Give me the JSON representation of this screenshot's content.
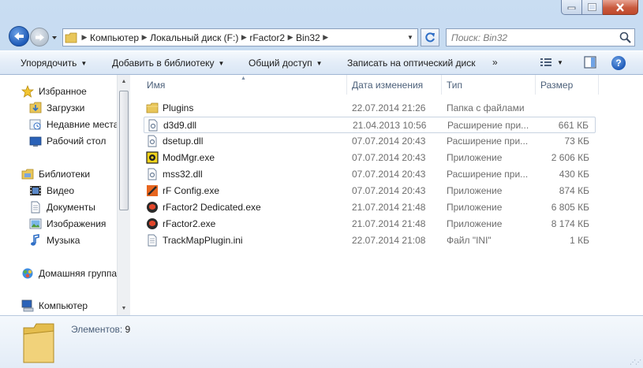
{
  "window": {
    "controls": {
      "minimize_icon": "minimize-icon",
      "maximize_icon": "maximize-icon",
      "close_icon": "close-icon"
    }
  },
  "navigation": {
    "breadcrumbs": [
      "Компьютер",
      "Локальный диск (F:)",
      "rFactor2",
      "Bin32"
    ],
    "search_placeholder": "Поиск: Bin32"
  },
  "toolbar": {
    "organize": "Упорядочить",
    "add_to_library": "Добавить в библиотеку",
    "share": "Общий доступ",
    "burn": "Записать на оптический диск",
    "more": "»"
  },
  "sidebar": {
    "favorites": "Избранное",
    "downloads": "Загрузки",
    "recent": "Недавние места",
    "desktop": "Рабочий стол",
    "libraries": "Библиотеки",
    "video": "Видео",
    "documents": "Документы",
    "images": "Изображения",
    "music": "Музыка",
    "homegroup": "Домашняя группа",
    "computer": "Компьютер"
  },
  "columns": {
    "name": "Имя",
    "date": "Дата изменения",
    "type": "Тип",
    "size": "Размер"
  },
  "files": [
    {
      "name": "Plugins",
      "date": "22.07.2014 21:26",
      "type": "Папка с файлами",
      "size": "",
      "icon": "folder-icon"
    },
    {
      "name": "d3d9.dll",
      "date": "21.04.2013 10:56",
      "type": "Расширение при...",
      "size": "661 КБ",
      "icon": "dll-file-icon"
    },
    {
      "name": "dsetup.dll",
      "date": "07.07.2014 20:43",
      "type": "Расширение при...",
      "size": "73 КБ",
      "icon": "dll-file-icon"
    },
    {
      "name": "ModMgr.exe",
      "date": "07.07.2014 20:43",
      "type": "Приложение",
      "size": "2 606 КБ",
      "icon": "modmgr-app-icon"
    },
    {
      "name": "mss32.dll",
      "date": "07.07.2014 20:43",
      "type": "Расширение при...",
      "size": "430 КБ",
      "icon": "dll-file-icon"
    },
    {
      "name": "rF Config.exe",
      "date": "07.07.2014 20:43",
      "type": "Приложение",
      "size": "874 КБ",
      "icon": "rf-config-app-icon"
    },
    {
      "name": "rFactor2 Dedicated.exe",
      "date": "21.07.2014 21:48",
      "type": "Приложение",
      "size": "6 805 КБ",
      "icon": "rfactor2-app-icon"
    },
    {
      "name": "rFactor2.exe",
      "date": "21.07.2014 21:48",
      "type": "Приложение",
      "size": "8 174 КБ",
      "icon": "rfactor2-app-icon"
    },
    {
      "name": "TrackMapPlugin.ini",
      "date": "22.07.2014 21:08",
      "type": "Файл \"INI\"",
      "size": "1 КБ",
      "icon": "ini-file-icon"
    }
  ],
  "status": {
    "count_label": "Элементов:",
    "count_value": "9"
  },
  "colors": {
    "frame": "#c9ddf2",
    "close_button": "#c95a3e",
    "header_text": "#4c607a",
    "meta_text": "#6d6d6d"
  }
}
